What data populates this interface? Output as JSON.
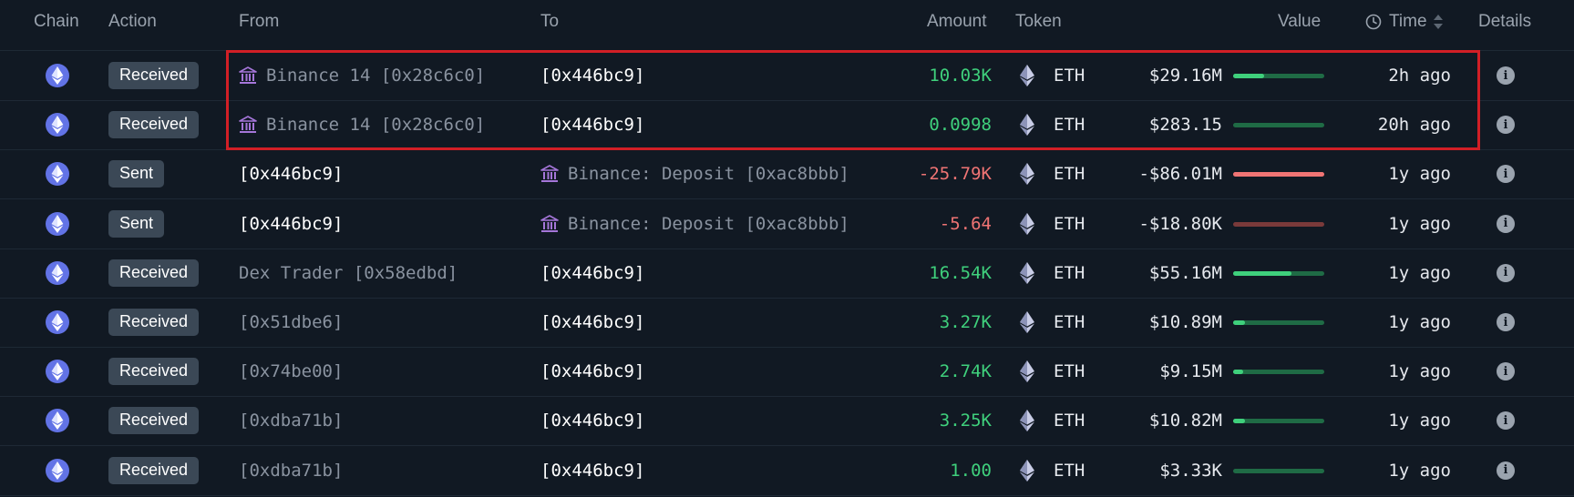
{
  "headers": {
    "chain": "Chain",
    "action": "Action",
    "from": "From",
    "to": "To",
    "amount": "Amount",
    "token": "Token",
    "value": "Value",
    "time": "Time",
    "details": "Details"
  },
  "icons": {
    "chain": "ethereum-icon",
    "token": "ethereum-icon",
    "entity": "bank-icon",
    "details": "info-icon",
    "time": "clock-icon",
    "sort": "sort-icon"
  },
  "colors": {
    "positive": "#3fd07c",
    "negative": "#f07474",
    "highlight_border": "#d21f26"
  },
  "rows": [
    {
      "action": "Received",
      "from": "Binance 14 [0x28c6c0]",
      "from_entity": true,
      "from_bright": false,
      "to": "[0x446bc9]",
      "to_entity": false,
      "to_bright": true,
      "amount": "10.03K",
      "sign": "pos",
      "token": "ETH",
      "value": "$29.16M",
      "bar_ratio": 0.34,
      "bar_type": "pos",
      "time": "2h ago"
    },
    {
      "action": "Received",
      "from": "Binance 14 [0x28c6c0]",
      "from_entity": true,
      "from_bright": false,
      "to": "[0x446bc9]",
      "to_entity": false,
      "to_bright": true,
      "amount": "0.0998",
      "sign": "pos",
      "token": "ETH",
      "value": "$283.15",
      "bar_ratio": 0.0,
      "bar_type": "pos",
      "time": "20h ago"
    },
    {
      "action": "Sent",
      "from": "[0x446bc9]",
      "from_entity": false,
      "from_bright": true,
      "to": "Binance: Deposit [0xac8bbb]",
      "to_entity": true,
      "to_bright": false,
      "amount": "-25.79K",
      "sign": "neg",
      "token": "ETH",
      "value": "-$86.01M",
      "bar_ratio": 1.0,
      "bar_type": "neg",
      "time": "1y ago"
    },
    {
      "action": "Sent",
      "from": "[0x446bc9]",
      "from_entity": false,
      "from_bright": true,
      "to": "Binance: Deposit [0xac8bbb]",
      "to_entity": true,
      "to_bright": false,
      "amount": "-5.64",
      "sign": "neg",
      "token": "ETH",
      "value": "-$18.80K",
      "bar_ratio": 0.0,
      "bar_type": "neg",
      "time": "1y ago"
    },
    {
      "action": "Received",
      "from": "Dex Trader [0x58edbd]",
      "from_entity": false,
      "from_bright": false,
      "to": "[0x446bc9]",
      "to_entity": false,
      "to_bright": true,
      "amount": "16.54K",
      "sign": "pos",
      "token": "ETH",
      "value": "$55.16M",
      "bar_ratio": 0.64,
      "bar_type": "pos",
      "time": "1y ago"
    },
    {
      "action": "Received",
      "from": "[0x51dbe6]",
      "from_entity": false,
      "from_bright": false,
      "to": "[0x446bc9]",
      "to_entity": false,
      "to_bright": true,
      "amount": "3.27K",
      "sign": "pos",
      "token": "ETH",
      "value": "$10.89M",
      "bar_ratio": 0.13,
      "bar_type": "pos",
      "time": "1y ago"
    },
    {
      "action": "Received",
      "from": "[0x74be00]",
      "from_entity": false,
      "from_bright": false,
      "to": "[0x446bc9]",
      "to_entity": false,
      "to_bright": true,
      "amount": "2.74K",
      "sign": "pos",
      "token": "ETH",
      "value": "$9.15M",
      "bar_ratio": 0.11,
      "bar_type": "pos",
      "time": "1y ago"
    },
    {
      "action": "Received",
      "from": "[0xdba71b]",
      "from_entity": false,
      "from_bright": false,
      "to": "[0x446bc9]",
      "to_entity": false,
      "to_bright": true,
      "amount": "3.25K",
      "sign": "pos",
      "token": "ETH",
      "value": "$10.82M",
      "bar_ratio": 0.13,
      "bar_type": "pos",
      "time": "1y ago"
    },
    {
      "action": "Received",
      "from": "[0xdba71b]",
      "from_entity": false,
      "from_bright": false,
      "to": "[0x446bc9]",
      "to_entity": false,
      "to_bright": true,
      "amount": "1.00",
      "sign": "pos",
      "token": "ETH",
      "value": "$3.33K",
      "bar_ratio": 0.0,
      "bar_type": "pos",
      "time": "1y ago"
    }
  ]
}
